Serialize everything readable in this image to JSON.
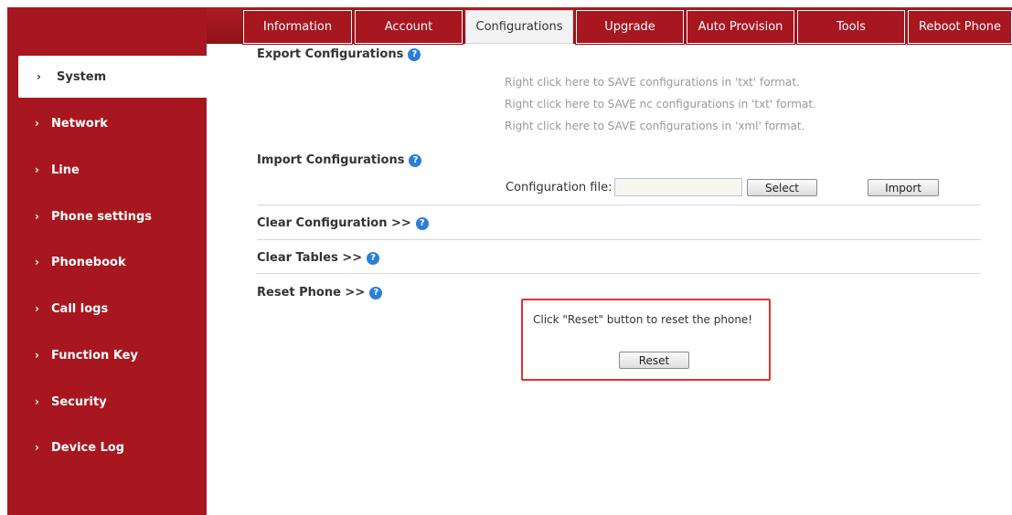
{
  "tabs": [
    {
      "label": "Information"
    },
    {
      "label": "Account"
    },
    {
      "label": "Configurations",
      "active": true
    },
    {
      "label": "Upgrade"
    },
    {
      "label": "Auto Provision"
    },
    {
      "label": "Tools"
    },
    {
      "label": "Reboot Phone"
    }
  ],
  "sidebar": {
    "items": [
      {
        "label": "System",
        "active": true
      },
      {
        "label": "Network"
      },
      {
        "label": "Line"
      },
      {
        "label": "Phone settings"
      },
      {
        "label": "Phonebook"
      },
      {
        "label": "Call logs"
      },
      {
        "label": "Function Key"
      },
      {
        "label": "Security"
      },
      {
        "label": "Device Log"
      }
    ],
    "chevron": "›"
  },
  "export": {
    "title": "Export Configurations",
    "lines": [
      "Right click here to SAVE configurations in 'txt' format.",
      "Right click here to SAVE nc configurations in 'txt' format.",
      "Right click here to SAVE configurations in 'xml' format."
    ]
  },
  "import": {
    "title": "Import Configurations",
    "file_label": "Configuration file:",
    "file_value": "",
    "select_label": "Select",
    "import_label": "Import"
  },
  "clear_config": {
    "title": "Clear Configuration >>"
  },
  "clear_tables": {
    "title": "Clear Tables >>"
  },
  "reset": {
    "title": "Reset Phone >>",
    "message": "Click \"Reset\" button to reset the phone!",
    "button_label": "Reset"
  },
  "help_glyph": "?",
  "colors": {
    "brand_red": "#a8171f",
    "help_blue": "#2b7ed8",
    "highlight": "#e0332e"
  }
}
